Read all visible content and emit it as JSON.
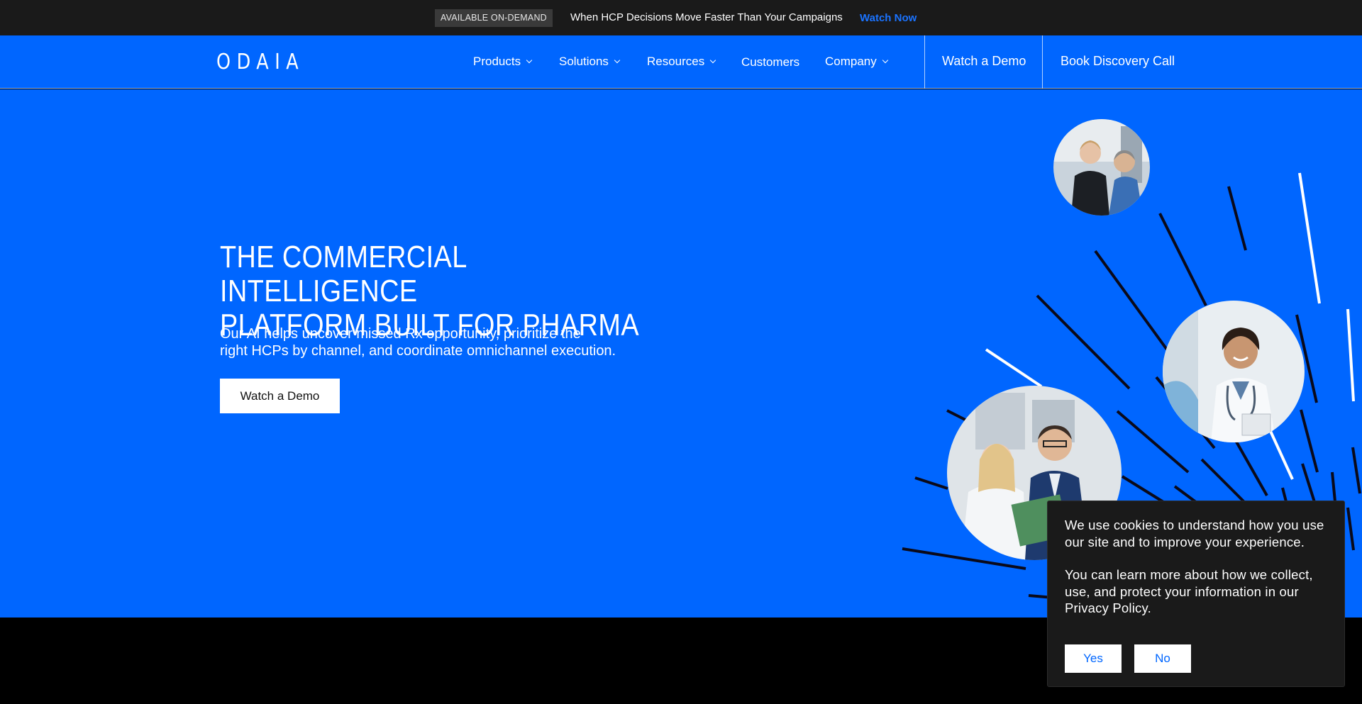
{
  "announcement": {
    "badge": "AVAILABLE ON-DEMAND",
    "message": "When HCP Decisions Move Faster Than Your Campaigns",
    "link": "Watch Now"
  },
  "nav": {
    "logo": "ODAIA",
    "items": [
      {
        "label": "Products",
        "has_dropdown": true
      },
      {
        "label": "Solutions",
        "has_dropdown": true
      },
      {
        "label": "Resources",
        "has_dropdown": true
      },
      {
        "label": "Customers",
        "has_dropdown": false
      },
      {
        "label": "Company",
        "has_dropdown": true
      }
    ],
    "cta_demo": "Watch a Demo",
    "cta_call": "Book Discovery Call"
  },
  "hero": {
    "headline_line1": "THE COMMERCIAL INTELLIGENCE",
    "headline_line2": "PLATFORM BUILT FOR PHARMA",
    "subtext_line1": "Our AI helps uncover missed Rx opportunity, prioritize the",
    "subtext_line2": "right HCPs by channel, and coordinate omnichannel execution.",
    "button": "Watch a Demo"
  },
  "cookie": {
    "text1": "We use cookies to understand how you use our site and to improve your experience.",
    "text2": "You can learn more about how we collect, use, and protect your information in our Privacy Policy.",
    "yes": "Yes",
    "no": "No"
  },
  "colors": {
    "brand_blue": "#0066ff",
    "dark": "#1a1a1a",
    "link_blue": "#1a73ff"
  }
}
